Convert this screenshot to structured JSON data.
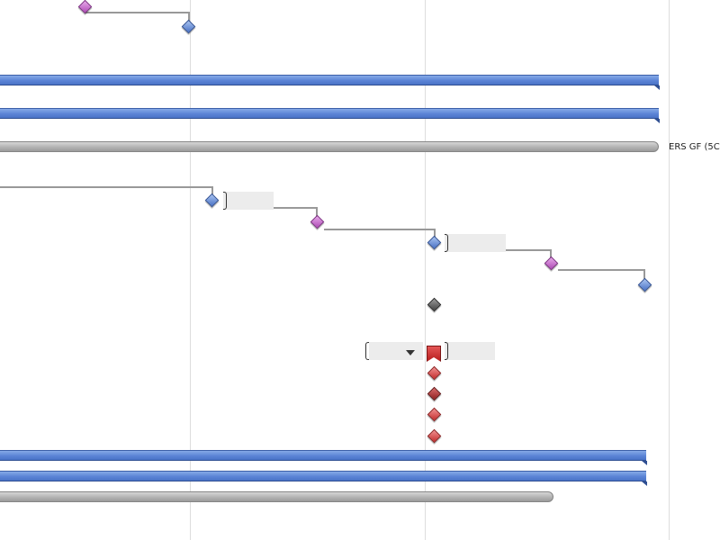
{
  "colors": {
    "task_bar": "#5b84d6",
    "summary_bar": "#aaaaaa",
    "milestone_blue": "#4a73c6",
    "milestone_purple": "#b04db6",
    "milestone_dark": "#444444",
    "milestone_red": "#c42e2e",
    "milestone_dark_red": "#8f2020",
    "connector": "#999999",
    "gridline": "#dddddd"
  },
  "summary_labels": [
    {
      "text": "ERS GF (5C"
    }
  ],
  "icons": {
    "dropdown": "triangle-down-icon",
    "flag": "flag-icon",
    "milestone": "diamond-icon"
  }
}
